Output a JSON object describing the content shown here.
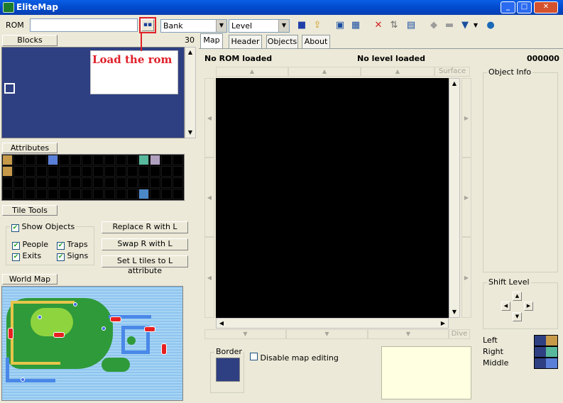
{
  "window": {
    "title": "EliteMap",
    "minimize": "_",
    "maximize": "□",
    "close": "✕"
  },
  "toolbar": {
    "rom_label": "ROM",
    "rom_value": "",
    "bank_value": "Bank",
    "level_value": "Level"
  },
  "blocks": {
    "label": "Blocks",
    "count": "30"
  },
  "annotation": {
    "text": "Load the rom"
  },
  "attributes": {
    "label": "Attributes"
  },
  "tile_tools": {
    "label": "Tile Tools"
  },
  "show_objects": {
    "label": "Show Objects",
    "people": "People",
    "traps": "Traps",
    "exits": "Exits",
    "signs": "Signs"
  },
  "actions": {
    "replace": "Replace R with L",
    "swap": "Swap R with L",
    "set_tiles": "Set L tiles to L attribute"
  },
  "world_map": {
    "label": "World Map"
  },
  "tabs": [
    "Map",
    "Header",
    "Objects",
    "About"
  ],
  "status": {
    "rom": "No ROM loaded",
    "level": "No level loaded",
    "offset": "000000"
  },
  "map": {
    "surface": "Surface",
    "dive": "Dive"
  },
  "border": {
    "label": "Border",
    "disable_editing": "Disable map editing"
  },
  "object_info": {
    "label": "Object Info"
  },
  "shift_level": {
    "label": "Shift Level"
  },
  "palette": {
    "left": "Left",
    "right": "Right",
    "middle": "Middle"
  },
  "colors": {
    "titlebar": "#0054e3",
    "block_bg": "#2e3f82",
    "map_bg": "#000000",
    "annotation": "#e0202a"
  }
}
